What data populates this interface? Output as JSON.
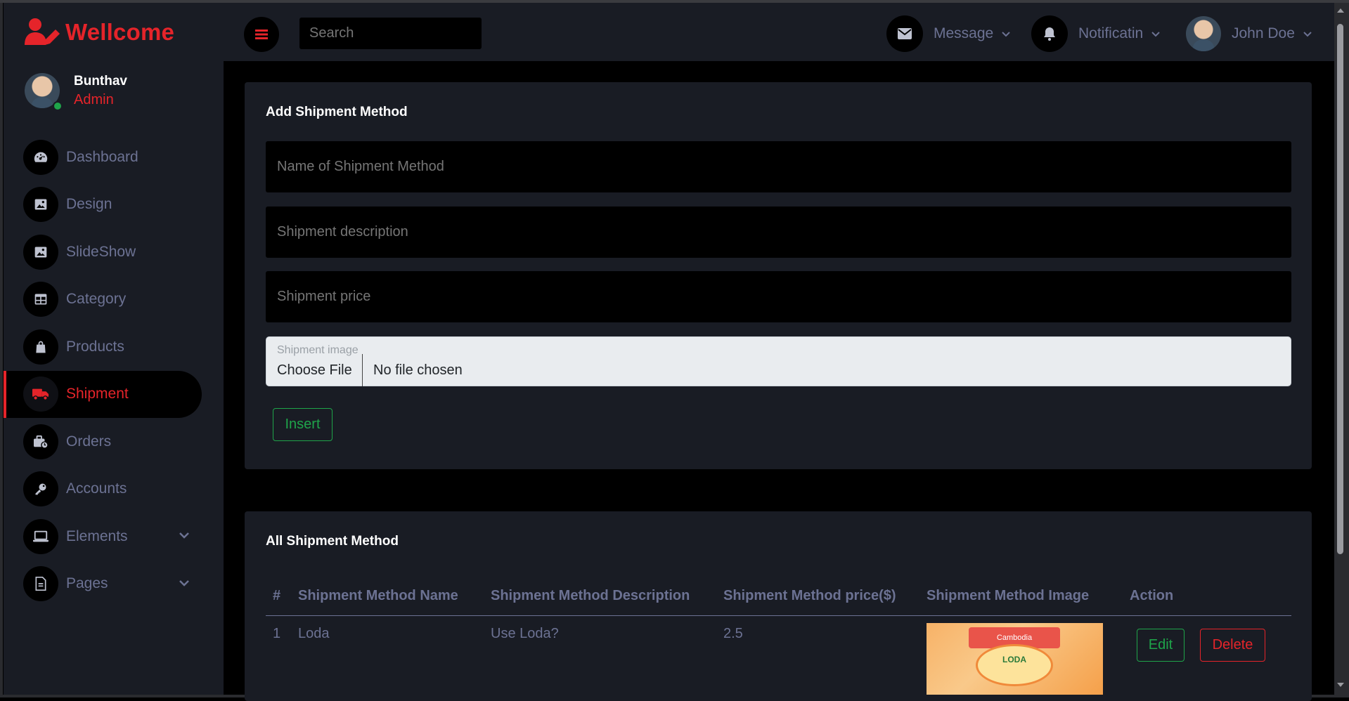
{
  "brand": {
    "name": "Wellcome",
    "color": "#e5242a"
  },
  "profile": {
    "name": "Bunthav",
    "role": "Admin",
    "status": "online"
  },
  "sidebar": {
    "items": [
      {
        "label": "Dashboard",
        "icon": "speedometer-icon"
      },
      {
        "label": "Design",
        "icon": "image-icon"
      },
      {
        "label": "SlideShow",
        "icon": "image-icon"
      },
      {
        "label": "Category",
        "icon": "table-icon"
      },
      {
        "label": "Products",
        "icon": "shopping-bag-icon"
      },
      {
        "label": "Shipment",
        "icon": "truck-icon",
        "active": true
      },
      {
        "label": "Orders",
        "icon": "briefcase-clock-icon"
      },
      {
        "label": "Accounts",
        "icon": "key-icon"
      },
      {
        "label": "Elements",
        "icon": "laptop-icon",
        "expandable": true
      },
      {
        "label": "Pages",
        "icon": "file-document-icon",
        "expandable": true
      }
    ]
  },
  "header": {
    "search_placeholder": "Search",
    "message_label": "Message",
    "notification_label": "Notificatin",
    "user_name": "John Doe"
  },
  "add_form": {
    "title": "Add Shipment Method",
    "name_placeholder": "Name of Shipment Method",
    "description_placeholder": "Shipment description",
    "price_placeholder": "Shipment price",
    "image_label": "Shipment image",
    "choose_file": "Choose File",
    "file_status": "No file chosen",
    "insert_label": "Insert"
  },
  "list": {
    "title": "All Shipment Method",
    "columns": [
      "#",
      "Shipment Method Name",
      "Shipment Method Description",
      "Shipment Method price($)",
      "Shipment Method Image",
      "Action"
    ],
    "rows": [
      {
        "index": "1",
        "name": "Loda",
        "description": "Use Loda?",
        "price": "2.5",
        "image_badge": "Cambodia",
        "image_logo": "LODA",
        "edit": "Edit",
        "delete": "Delete"
      }
    ]
  },
  "colors": {
    "accent": "#e5242a",
    "success": "#1fa44a",
    "panel": "#191c24",
    "muted": "#6c7293"
  }
}
